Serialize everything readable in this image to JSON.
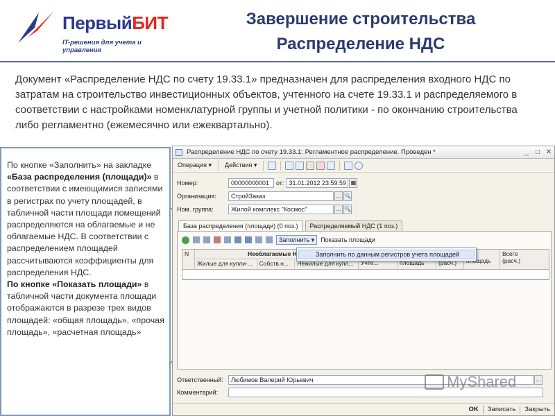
{
  "logo": {
    "brand_part1": "Первый",
    "brand_part2": "БИТ",
    "tagline": "IT-решения для учета и управления"
  },
  "slide": {
    "title_line1": "Завершение строительства",
    "title_line2": "Распределение НДС"
  },
  "intro": "Документ «Распределение НДС по счету 19.33.1» предназначен для распределения входного НДС по затратам на строительство инвестиционных объектов, учтенного на счете 19.33.1 и распределяемого в соответствии с настройками номенклатурной группы и учетной политики - по окончанию строительства либо регламентно (ежемесячно или ежеквартально).",
  "left_text": {
    "p1": "По кнопке «Заполнить» на закладке ",
    "p1_bold": "«База распределения (площади)»",
    "p1_rest": " в соответствии с имеющимися записями в регистрах по учету площадей, в табличной части площади помещений распределяются на облагаемые и не облагаемые НДС. В соответствии с распределением площадей рассчитываются коэффициенты для распределения НДС.",
    "p2_bold": "По кнопке «Показать площади»",
    "p2_rest": " в табличной части документа площади отображаются в разрезе трех видов площадей: «общая площадь», «прочая площадь», «расчетная площадь»"
  },
  "window": {
    "title": "Распределение НДС по счету 19.33.1: Регламентное распределение. Проведен *",
    "toolbar": {
      "operation": "Операция ▾",
      "actions": "Действия ▾"
    },
    "fields": {
      "number_label": "Номер:",
      "number_value": "00000000001",
      "from_label": "от:",
      "date_value": "31.01.2012 23:59:59",
      "org_label": "Организация:",
      "org_value": "СтройЗаказ",
      "nomgroup_label": "Ном. группа:",
      "nomgroup_value": "Жилой комплекс \"Космос\""
    },
    "tabs": [
      {
        "label": "База распределения (площади) (0 поз.)"
      },
      {
        "label": "Распределяемый НДС (1 поз.)"
      }
    ],
    "panel_toolbar": {
      "fill": "Заполнить ▾",
      "show_areas": "Показать площади"
    },
    "dropdown_item": "Заполнить по данным регистров учета площадей",
    "grid": {
      "col_n": "N",
      "col_untaxed": "Необлагаемые НДС",
      "sub_living": "Жилые для купли-...",
      "sub_own": "Собств.н...",
      "sub_nonliving": "Нежилые для купл...",
      "sub_share": "Учте...",
      "col_area": "площадь",
      "col_calc": "(расч.)",
      "col_tpart": "ля",
      "col_tsub": "площадь",
      "col_total": "Всего",
      "col_total2": "(расч.)"
    },
    "responsible_label": "Ответственный:",
    "responsible_value": "Любимов Валерий Юрьевич",
    "comment_label": "Комментарий:",
    "footer": {
      "ok": "OK",
      "save": "Записать",
      "close": "Закрыть"
    }
  },
  "watermark": "MyShared"
}
